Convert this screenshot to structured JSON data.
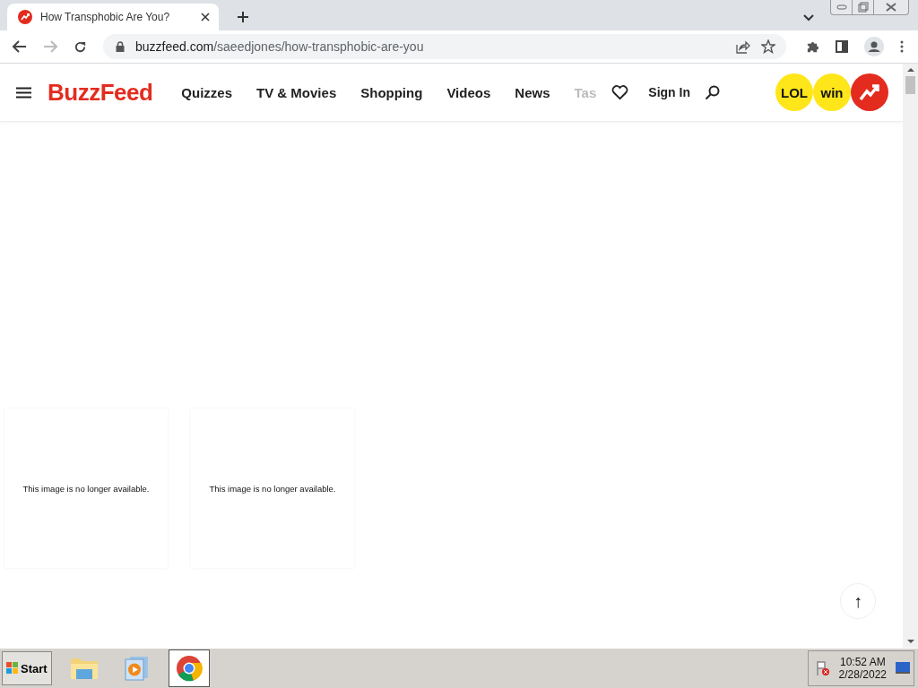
{
  "browser": {
    "tabs": [
      {
        "title": "How Transphobic Are You?",
        "selected": true
      }
    ],
    "url_host": "buzzfeed.com",
    "url_path": "/saeedjones/how-transphobic-are-you"
  },
  "site": {
    "logo": "BuzzFeed",
    "nav": [
      "Quizzes",
      "TV & Movies",
      "Shopping",
      "Videos",
      "News",
      "Tas"
    ],
    "sign_in": "Sign In",
    "badges": [
      {
        "label": "LOL",
        "kind": "text",
        "color": "#ffe61a"
      },
      {
        "label": "win",
        "kind": "text",
        "color": "#ffe61a"
      },
      {
        "kind": "trending",
        "color": "#e32c1e"
      }
    ]
  },
  "content": {
    "images": [
      {
        "message": "This image is no longer available."
      },
      {
        "message": "This image is no longer available."
      }
    ],
    "back_to_top": "↑"
  },
  "taskbar": {
    "start": "Start",
    "apps": [
      {
        "kind": "folder",
        "selected": false
      },
      {
        "kind": "media",
        "selected": false
      },
      {
        "kind": "chrome",
        "selected": true
      }
    ],
    "time": "10:52 AM",
    "date": "2/28/2022"
  }
}
